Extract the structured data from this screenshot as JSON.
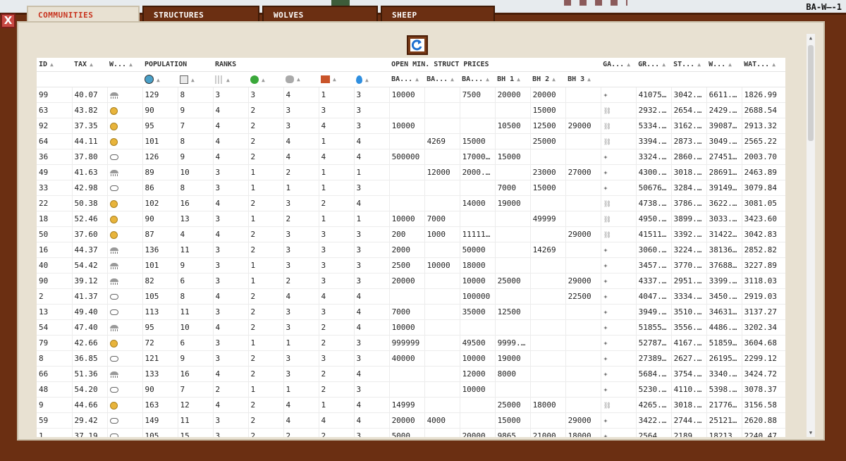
{
  "world_label": "BA-W–-1",
  "tabs": [
    {
      "label": "COMMUNITIES",
      "active": true
    },
    {
      "label": "STRUCTURES",
      "active": false
    },
    {
      "label": "WOLVES",
      "active": false
    },
    {
      "label": "SHEEP",
      "active": false
    }
  ],
  "close_label": "X",
  "headers": {
    "id": "ID",
    "tax": "TAX",
    "weather": "W...",
    "population": "POPULATION",
    "ranks": "RANKS",
    "open_min": "OPEN MIN. STRUCT PRICES",
    "ga": "GA...",
    "gr": "GR...",
    "st": "ST...",
    "w": "W...",
    "wat": "WAT...",
    "ba1": "BA...",
    "ba2": "BA...",
    "ba3": "BA...",
    "bh1": "BH 1",
    "bh2": "BH 2",
    "bh3": "BH 3"
  },
  "rows": [
    [
      "99",
      "40.07",
      "storm",
      "129",
      "8",
      "3",
      "3",
      "4",
      "1",
      "3",
      "10000",
      "",
      "7500",
      "20000",
      "20000",
      "",
      "wolf",
      "41075...",
      "3042....",
      "6611.16",
      "1826.99"
    ],
    [
      "63",
      "43.82",
      "coin",
      "90",
      "9",
      "4",
      "2",
      "3",
      "3",
      "3",
      "",
      "",
      "",
      "",
      "15000",
      "",
      "chain",
      "2932...",
      "2654....",
      "2429....",
      "2688.54"
    ],
    [
      "92",
      "37.35",
      "coin",
      "95",
      "7",
      "4",
      "2",
      "3",
      "4",
      "3",
      "10000",
      "",
      "",
      "10500",
      "12500",
      "29000",
      "chain",
      "5334...",
      "3162.86",
      "39087...",
      "2913.32"
    ],
    [
      "64",
      "44.11",
      "coin",
      "101",
      "8",
      "4",
      "2",
      "4",
      "1",
      "4",
      "",
      "4269",
      "15000",
      "",
      "25000",
      "",
      "chain",
      "3394...",
      "2873.14",
      "3049....",
      "2565.22"
    ],
    [
      "36",
      "37.80",
      "cloud",
      "126",
      "9",
      "4",
      "2",
      "4",
      "4",
      "4",
      "500000",
      "",
      "17000...",
      "15000",
      "",
      "",
      "wolf",
      "3324...",
      "2860....",
      "27451...",
      "2003.70"
    ],
    [
      "49",
      "41.63",
      "storm",
      "89",
      "10",
      "3",
      "1",
      "2",
      "1",
      "1",
      "",
      "12000",
      "2000...",
      "",
      "23000",
      "27000",
      "wolf",
      "4300...",
      "3018.52",
      "28691...",
      "2463.89"
    ],
    [
      "33",
      "42.98",
      "cloud",
      "86",
      "8",
      "3",
      "1",
      "1",
      "1",
      "3",
      "",
      "",
      "",
      "7000",
      "15000",
      "",
      "wolf",
      "50676...",
      "3284....",
      "39149...",
      "3079.84"
    ],
    [
      "22",
      "50.38",
      "coin",
      "102",
      "16",
      "4",
      "2",
      "3",
      "2",
      "4",
      "",
      "",
      "14000",
      "19000",
      "",
      "",
      "chain",
      "4738...",
      "3786.32",
      "3622....",
      "3081.05"
    ],
    [
      "18",
      "52.46",
      "coin",
      "90",
      "13",
      "3",
      "1",
      "2",
      "1",
      "1",
      "10000",
      "7000",
      "",
      "",
      "49999",
      "",
      "chain",
      "4950...",
      "3899....",
      "3033....",
      "3423.60"
    ],
    [
      "50",
      "37.60",
      "coin",
      "87",
      "4",
      "4",
      "2",
      "3",
      "3",
      "3",
      "200",
      "1000",
      "1111111",
      "",
      "",
      "29000",
      "chain",
      "41511...",
      "3392.41",
      "31422...",
      "3042.83"
    ],
    [
      "16",
      "44.37",
      "storm",
      "136",
      "11",
      "3",
      "2",
      "3",
      "3",
      "3",
      "2000",
      "",
      "50000",
      "",
      "14269",
      "",
      "wolf",
      "3060...",
      "3224....",
      "38136...",
      "2852.82"
    ],
    [
      "40",
      "54.42",
      "storm",
      "101",
      "9",
      "3",
      "1",
      "3",
      "3",
      "3",
      "2500",
      "10000",
      "18000",
      "",
      "",
      "",
      "wolf",
      "3457...",
      "3770.55",
      "37688...",
      "3227.89"
    ],
    [
      "90",
      "39.12",
      "storm",
      "82",
      "6",
      "3",
      "1",
      "2",
      "3",
      "3",
      "20000",
      "",
      "10000",
      "25000",
      "",
      "29000",
      "wolf",
      "4337...",
      "2951.51",
      "3399....",
      "3118.03"
    ],
    [
      "2",
      "41.37",
      "cloud",
      "105",
      "8",
      "4",
      "2",
      "4",
      "4",
      "4",
      "",
      "",
      "100000",
      "",
      "",
      "22500",
      "wolf",
      "4047...",
      "3334....",
      "3450....",
      "2919.03"
    ],
    [
      "13",
      "49.40",
      "cloud",
      "113",
      "11",
      "3",
      "2",
      "3",
      "3",
      "4",
      "7000",
      "",
      "35000",
      "12500",
      "",
      "",
      "wolf",
      "3949...",
      "3510.19",
      "34631...",
      "3137.27"
    ],
    [
      "54",
      "47.40",
      "storm",
      "95",
      "10",
      "4",
      "2",
      "3",
      "2",
      "4",
      "10000",
      "",
      "",
      "",
      "",
      "",
      "wolf",
      "51855...",
      "3556....",
      "4486....",
      "3202.34"
    ],
    [
      "79",
      "42.66",
      "coin",
      "72",
      "6",
      "3",
      "1",
      "1",
      "2",
      "3",
      "999999",
      "",
      "49500",
      "9999...",
      "",
      "",
      "wolf",
      "52787...",
      "4167.28",
      "51859...",
      "3604.68"
    ],
    [
      "8",
      "36.85",
      "cloud",
      "121",
      "9",
      "3",
      "2",
      "3",
      "3",
      "3",
      "40000",
      "",
      "10000",
      "19000",
      "",
      "",
      "wolf",
      "27389...",
      "2627.23",
      "26195...",
      "2299.12"
    ],
    [
      "66",
      "51.36",
      "storm",
      "133",
      "16",
      "4",
      "2",
      "3",
      "2",
      "4",
      "",
      "",
      "12000",
      "8000",
      "",
      "",
      "wolf",
      "5684...",
      "3754....",
      "3340....",
      "3424.72"
    ],
    [
      "48",
      "54.20",
      "cloud",
      "90",
      "7",
      "2",
      "1",
      "1",
      "2",
      "3",
      "",
      "",
      "10000",
      "",
      "",
      "",
      "wolf",
      "5230...",
      "4110.71",
      "5398....",
      "3078.37"
    ],
    [
      "9",
      "44.66",
      "coin",
      "163",
      "12",
      "4",
      "2",
      "4",
      "1",
      "4",
      "14999",
      "",
      "",
      "25000",
      "18000",
      "",
      "chain",
      "4265...",
      "3018.82",
      "21776...",
      "3156.58"
    ],
    [
      "59",
      "29.42",
      "cloud",
      "149",
      "11",
      "3",
      "2",
      "4",
      "4",
      "4",
      "20000",
      "4000",
      "",
      "15000",
      "",
      "29000",
      "wolf",
      "3422...",
      "2744....",
      "25121...",
      "2620.88"
    ],
    [
      "1",
      "37.19",
      "cloud",
      "105",
      "15",
      "3",
      "2",
      "2",
      "2",
      "3",
      "5000",
      "",
      "20000",
      "9865",
      "21000",
      "18000...",
      "wolf",
      "2564...",
      "2189.07",
      "18213...",
      "2240.47"
    ]
  ]
}
